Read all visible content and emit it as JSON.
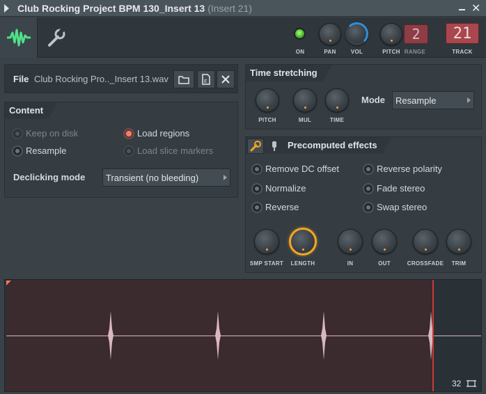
{
  "window": {
    "title": "Club Rocking Project BPM 130_Insert 13",
    "subtitle": "(Insert 21)"
  },
  "toolbar": {
    "knobs": {
      "on": "ON",
      "pan": "PAN",
      "vol": "VOL",
      "pitch": "PITCH",
      "range": "RANGE",
      "track": "TRACK"
    },
    "range_value": "2",
    "track_value": "21"
  },
  "file": {
    "label": "File",
    "name": "Club Rocking Pro.._Insert 13.wav"
  },
  "content": {
    "title": "Content",
    "options": {
      "keep_on_disk": "Keep on disk",
      "resample": "Resample",
      "load_regions": "Load regions",
      "load_slice_markers": "Load slice markers"
    },
    "declicking_label": "Declicking mode",
    "declicking_value": "Transient (no bleeding)"
  },
  "time_stretching": {
    "title": "Time stretching",
    "knobs": {
      "pitch": "PITCH",
      "mul": "MUL",
      "time": "TIME"
    },
    "mode_label": "Mode",
    "mode_value": "Resample"
  },
  "precomputed": {
    "title": "Precomputed effects",
    "effects": {
      "remove_dc": "Remove DC offset",
      "normalize": "Normalize",
      "reverse": "Reverse",
      "reverse_polarity": "Reverse polarity",
      "fade_stereo": "Fade stereo",
      "swap_stereo": "Swap stereo"
    },
    "knobs": {
      "smp_start": "SMP START",
      "length": "LENGTH",
      "in": "IN",
      "out": "OUT",
      "crossfade": "CROSSFADE",
      "trim": "TRIM"
    }
  },
  "waveform": {
    "zoom": "32"
  },
  "colors": {
    "accent_orange": "#f5a623",
    "accent_green": "#3ee07a",
    "accent_blue": "#2e8fd9",
    "lcd_red": "#8c3d45",
    "radio_on": "#ff7a66"
  }
}
